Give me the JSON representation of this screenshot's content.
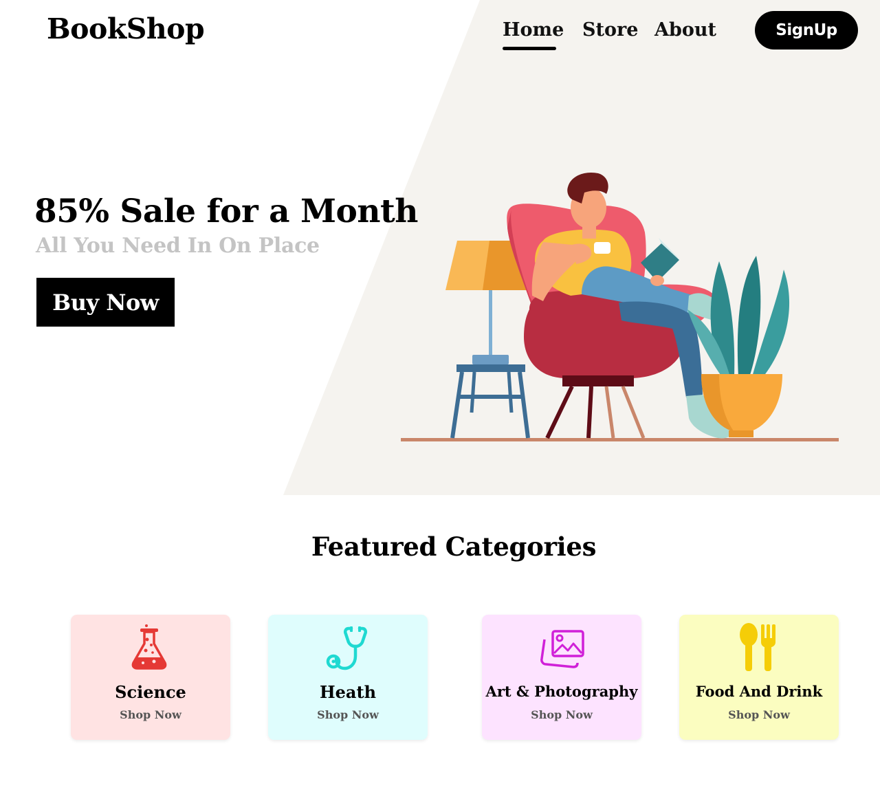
{
  "header": {
    "brand": "BookShop",
    "nav": [
      {
        "label": "Home",
        "active": true
      },
      {
        "label": "Store",
        "active": false
      },
      {
        "label": "About",
        "active": false
      }
    ],
    "signup_label": "SignUp"
  },
  "hero": {
    "title": "85% Sale for a Month",
    "subtitle": "All You Need In On Place",
    "cta_label": "Buy Now",
    "illustration": "man-reading-book-in-armchair"
  },
  "categories": {
    "title": "Featured Categories",
    "items": [
      {
        "name": "Science",
        "link": "Shop Now",
        "icon": "flask-icon",
        "color": "#e53935",
        "bg": "#ffe3e3"
      },
      {
        "name": "Heath",
        "link": "Shop Now",
        "icon": "stethoscope-icon",
        "color": "#1fd9d1",
        "bg": "#dffdfd"
      },
      {
        "name": "Art & Photography",
        "link": "Shop Now",
        "icon": "images-icon",
        "color": "#d020d8",
        "bg": "#fde3ff"
      },
      {
        "name": "Food And Drink",
        "link": "Shop Now",
        "icon": "spoon-fork-icon",
        "color": "#f5cd07",
        "bg": "#fbfdc0"
      }
    ]
  },
  "colors": {
    "hero_panel": "#f5f3ef",
    "primary": "#000000",
    "muted_text": "#c4c4c4"
  }
}
